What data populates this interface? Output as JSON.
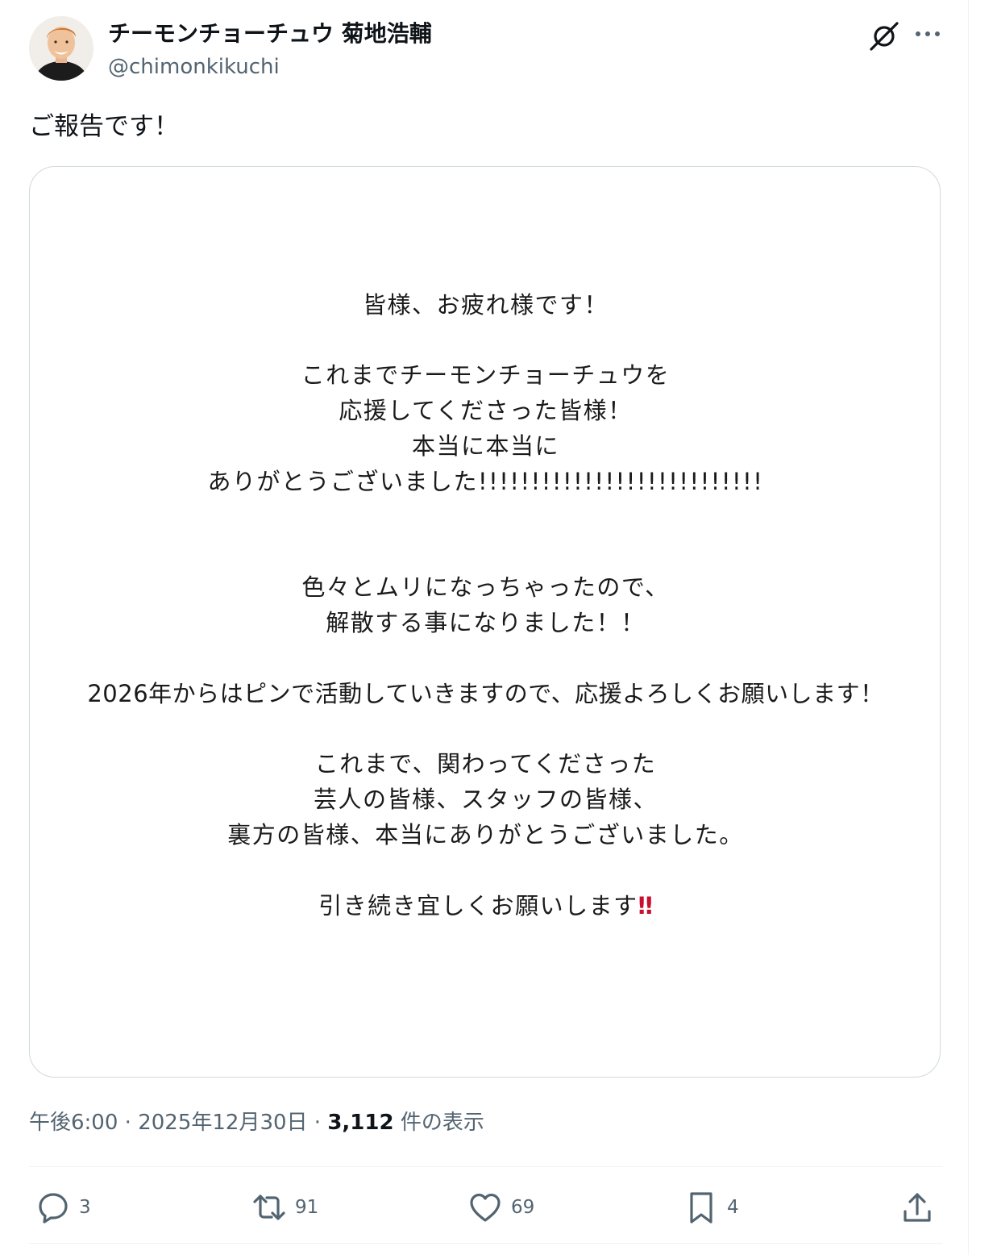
{
  "author": {
    "display_name": "チーモンチョーチュウ 菊地浩輔",
    "handle": "@chimonkikuchi"
  },
  "header_icons": [
    "grok-icon",
    "more-icon"
  ],
  "post": {
    "text": "ご報告です！"
  },
  "notice": {
    "lines": [
      "皆様、お疲れ様です！",
      "これまでチーモンチョーチュウを",
      "応援してくださった皆様！",
      "本当に本当に",
      "ありがとうございました!!!!!!!!!!!!!!!!!!!!!!!!!!!",
      "色々とムリになっちゃったので、",
      "解散する事になりました！！",
      "2026年からはピンで活動していきますので、応援よろしくお願いします！",
      "これまで、関わってくださった",
      "芸人の皆様、スタッフの皆様、",
      "裏方の皆様、本当にありがとうございました。",
      "引き続き宜しくお願いします"
    ],
    "final_emphasis": "‼",
    "emphasis_color": "#c8102e"
  },
  "meta": {
    "time": "午後6:00",
    "separator": "·",
    "date": "2025年12月30日",
    "views_count": "3,112",
    "views_label": "件の表示"
  },
  "actions": {
    "replies": "3",
    "reposts": "91",
    "likes": "69",
    "bookmarks": "4"
  },
  "colors": {
    "text_primary": "#0f1419",
    "text_secondary": "#536471",
    "border": "#cfd9de",
    "divider": "#eff3f4"
  }
}
